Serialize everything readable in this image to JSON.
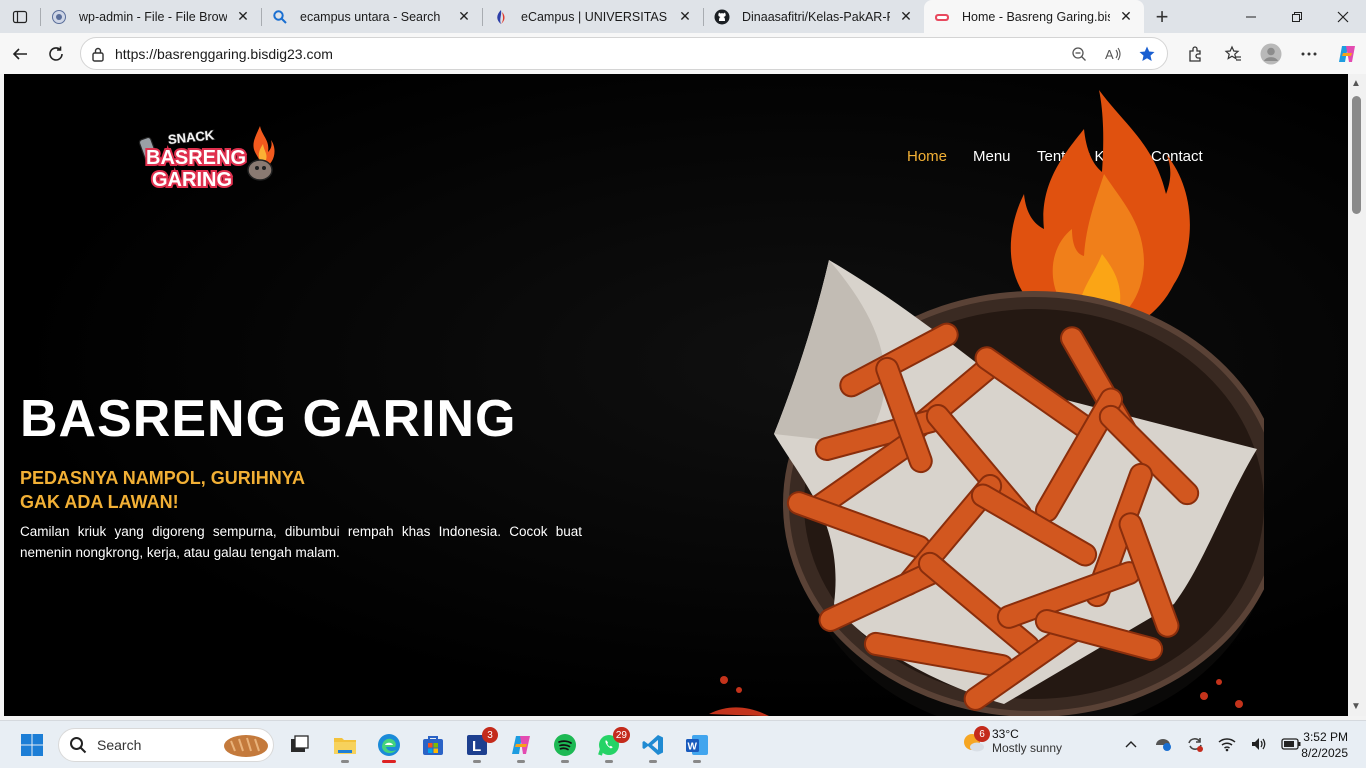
{
  "browser": {
    "tabs": [
      {
        "title": "wp-admin - File - File Browser",
        "icon": "globe-icon",
        "active": false
      },
      {
        "title": "ecampus untara - Search",
        "icon": "search-icon",
        "active": false
      },
      {
        "title": "eCampus | UNIVERSITAS TANG",
        "icon": "ecampus-icon",
        "active": false
      },
      {
        "title": "Dinaasafitri/Kelas-PakAR-Pera",
        "icon": "github-icon",
        "active": false
      },
      {
        "title": "Home - Basreng Garing.bisdig",
        "icon": "basreng-favicon",
        "active": true
      }
    ],
    "url": "https://basrenggaring.bisdig23.com"
  },
  "site": {
    "logo": {
      "line1": "SNACK",
      "line2": "BASRENG",
      "line3": "GARING"
    },
    "nav": [
      {
        "label": "Home",
        "active": true
      },
      {
        "label": "Menu",
        "active": false
      },
      {
        "label": "Tentang Kami",
        "active": false
      },
      {
        "label": "Contact",
        "active": false
      }
    ],
    "hero": {
      "title": "BASRENG GARING",
      "subtitle_line1": "PEDASNYA NAMPOL, GURIHNYA",
      "subtitle_line2": "GAK ADA LAWAN!",
      "description": "Camilan kriuk yang digoreng sempurna, dibumbui rempah khas Indonesia. Cocok buat nemenin nongkrong, kerja, atau galau tengah malam."
    },
    "colors": {
      "accent": "#f2b035",
      "background": "#000000",
      "text": "#ffffff"
    }
  },
  "taskbar": {
    "search_label": "Search",
    "badges": {
      "lumin": "3",
      "whatsapp": "29",
      "weather": "6"
    },
    "weather": {
      "temp": "33°C",
      "condition": "Mostly sunny"
    },
    "clock": {
      "time": "3:52 PM",
      "date": "8/2/2025"
    }
  }
}
